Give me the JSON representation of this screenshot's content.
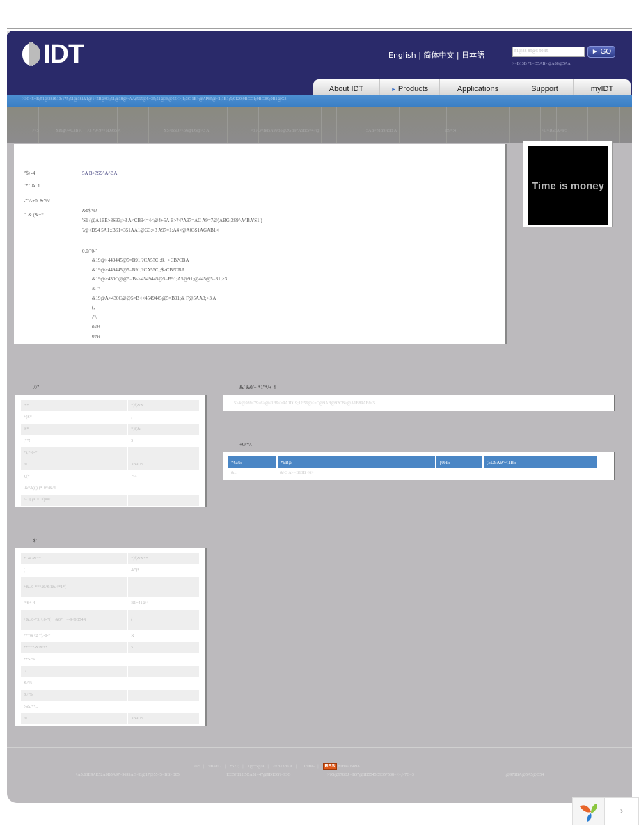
{
  "header": {
    "logo_text": "IDT",
    "languages": "English  | 简体中文 | 日本語",
    "search_placeholder": "51@38-89@5 99B5",
    "search_button": "GO",
    "search_hint": ">=B13B *1=D5AB>@A88@5AA"
  },
  "nav": {
    "items": [
      {
        "label": "About IDT",
        "arrow": false
      },
      {
        "label": "Products",
        "arrow": true
      },
      {
        "label": "Applications",
        "arrow": false
      },
      {
        "label": "Support",
        "arrow": false
      },
      {
        "label": "myIDT",
        "arrow": false
      }
    ]
  },
  "breadcrumb": ">3C<5=B;51@38l&13:175;51@38l&1@1<5B@93;51@38@>AA(565@5=35;51@38@55<>;1;3C;1B>@AP85@<1;1B1;5;9129;9BGC1;9BGB9;9B1@G3",
  "subnav": [
    "><5",
    "&&@>4C3B A",
    ">3 *9<9=75D935 A",
    "&5>B5D><56@D5@>3 A",
    ">3 A3=B85A99B5@2GB9?A5B;5=4>@",
    "5AB>?8B9A5B A",
    "B9=;4",
    "<C<1GI;A>9:5"
  ],
  "main": {
    "rows": [
      {
        "label": "/'$+-4",
        "value": "5A B>?S9^A^BA",
        "link": true
      },
      {
        "label": "\"*\"-&-4",
        "value": ""
      },
      {
        "label": "-\"\"/-+0, &'%!",
        "value": ""
      },
      {
        "label": "\"..&.(&+*",
        "value": "&#$'%!"
      }
    ],
    "description_lines": [
      "'S1 (@A1BE>3S93;>3 A<CB9<=4<@4+5A B>?4?A97=AC A9=7@)ABG;3S9^A^BA'S1 )",
      "?@<D94 5A1;;BS1=351AA1@G3;>3 A97=1;A4<@A03S1AGAB1<"
    ],
    "list_title": "0.0/\"0-\"",
    "list_items": [
      "&19@>449445@5=B91;?CA5?C;;&+>CB?CBA",
      "&19@>449445@5=B91;?CA5?C;;$>CB?CBA",
      "&19@>430C@@5=B<<4549445@5=B91;A5@91;@445@5=31;>3",
      "& \"\\",
      "&19@A>430C@@5=B<<4549445@5=B91;& F@5AA3;>3 A",
      "(,",
      "/\"\\",
      "0#H",
      "0#H"
    ]
  },
  "ad": {
    "text": "Time is money"
  },
  "spec_table_1": {
    "title": "-/'/\"-",
    "rows": [
      {
        "label": "'S*",
        "value": "*)f(&&",
        "alt": true
      },
      {
        "label": "+(S*",
        "value": ",",
        "alt": false
      },
      {
        "label": "'S*",
        "value": "*)f(&",
        "alt": true
      },
      {
        "label": ",**!",
        "value": "5",
        "alt": false
      },
      {
        "label": "*),*-0-*",
        "value": "",
        "alt": true
      },
      {
        "label": "/0.",
        "value": "3B9D5",
        "alt": true
      },
      {
        "label": "),(*",
        "value": ".5A",
        "alt": false
      },
      {
        "label": ".&*&)()-(*-0*/&/4",
        "value": "",
        "alt": false
      },
      {
        "label": "/+-4-(*-* -*)**/",
        "value": "",
        "alt": true
      }
    ]
  },
  "notes": {
    "title": "&/-&0/+-*1\"*/+-4",
    "text": "5>&@939<79<6>@<1B9<=9A1D19;12;56@<=C@9AB@92CB>@A1B89AB9<5"
  },
  "ordering": {
    "title": "+0/'*/.",
    "headers": [
      "*G?5",
      "*9B;5",
      "}0H5",
      "(5D9A9><1B5"
    ],
    "rows": [
      [
        "&..",
        "&>3 A>=B13B <6>",
        "|",
        ""
      ]
    ]
  },
  "spec_table_2": {
    "title": "$'",
    "rows": [
      {
        "label": "*..&./&+*",
        "value": "*)f(&&**",
        "alt": true,
        "tall": false
      },
      {
        "label": "(..",
        "value": "&\")*",
        "alt": false,
        "tall": false
      },
      {
        "label": "+&./0-***.&/&1&/4*1*(",
        "value": "",
        "alt": true,
        "tall": true
      },
      {
        "label": "/*S+-4",
        "value": "B1=41@4",
        "alt": false,
        "tall": false
      },
      {
        "label": "+&./0-*3,+,0-*(++&0* +<-9<9B54X",
        "value": "(",
        "alt": true,
        "tall": true
      },
      {
        "label": "***0(+2 *),-0-*",
        "value": "X",
        "alt": false,
        "tall": false
      },
      {
        "label": "***+*/&/&+*.",
        "value": "5",
        "alt": true,
        "tall": false
      },
      {
        "label": "**S/%",
        "value": "",
        "alt": false,
        "tall": false
      },
      {
        "label": "-/",
        "value": "",
        "alt": true,
        "tall": false
      },
      {
        "label": "&/'%",
        "value": "",
        "alt": false,
        "tall": false
      },
      {
        "label": "&/ %",
        "value": "",
        "alt": true,
        "tall": false
      },
      {
        "label": "%&/**..",
        "value": "",
        "alt": false,
        "tall": false
      },
      {
        "label": "/0.",
        "value": "3B9D5",
        "alt": true,
        "tall": false
      }
    ]
  },
  "footer": {
    "links": [
      "><5",
      "9B5#17",
      "*571;",
      "1@55@A",
      ">=B13B<A",
      "C1;9BG"
    ],
    "rss_label": "RSS",
    "rss_text": "81B9AB89A",
    "copyright": [
      "+A5:63B9AE52A9B5A97=9695AG<C@17@55<5=BB>B85",
      "1335?B12;5CA51=47@9D13G?=93G",
      ">?G@978BJ =B57@1B5545D935*538=<=;>7G=3",
      ";@978BA@5A5@D54"
    ]
  }
}
